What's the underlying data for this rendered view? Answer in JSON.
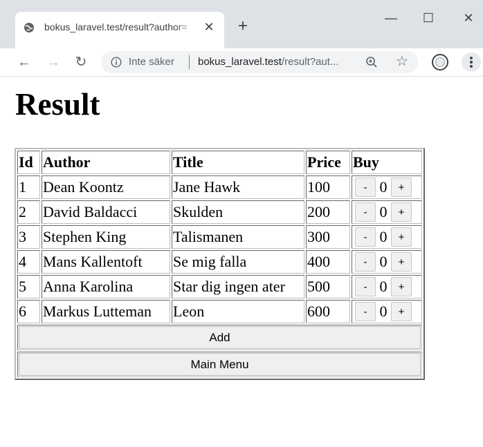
{
  "browser": {
    "tab": {
      "title": "bokus_laravel.test/result?author="
    },
    "omnibox": {
      "security": "Inte säker",
      "url_host": "bokus_laravel.test",
      "url_path": "/result?aut..."
    }
  },
  "page": {
    "title": "Result",
    "table": {
      "headers": {
        "id": "Id",
        "author": "Author",
        "title": "Title",
        "price": "Price",
        "buy": "Buy"
      },
      "rows": [
        {
          "id": "1",
          "author": "Dean Koontz",
          "title": "Jane Hawk",
          "price": "100",
          "qty": "0"
        },
        {
          "id": "2",
          "author": "David Baldacci",
          "title": "Skulden",
          "price": "200",
          "qty": "0"
        },
        {
          "id": "3",
          "author": "Stephen King",
          "title": "Talismanen",
          "price": "300",
          "qty": "0"
        },
        {
          "id": "4",
          "author": "Mans Kallentoft",
          "title": "Se mig falla",
          "price": "400",
          "qty": "0"
        },
        {
          "id": "5",
          "author": "Anna Karolina",
          "title": "Star dig ingen ater",
          "price": "500",
          "qty": "0"
        },
        {
          "id": "6",
          "author": "Markus Lutteman",
          "title": "Leon",
          "price": "600",
          "qty": "0"
        }
      ],
      "minus_label": "-",
      "plus_label": "+"
    },
    "add_label": "Add",
    "main_menu_label": "Main Menu"
  }
}
